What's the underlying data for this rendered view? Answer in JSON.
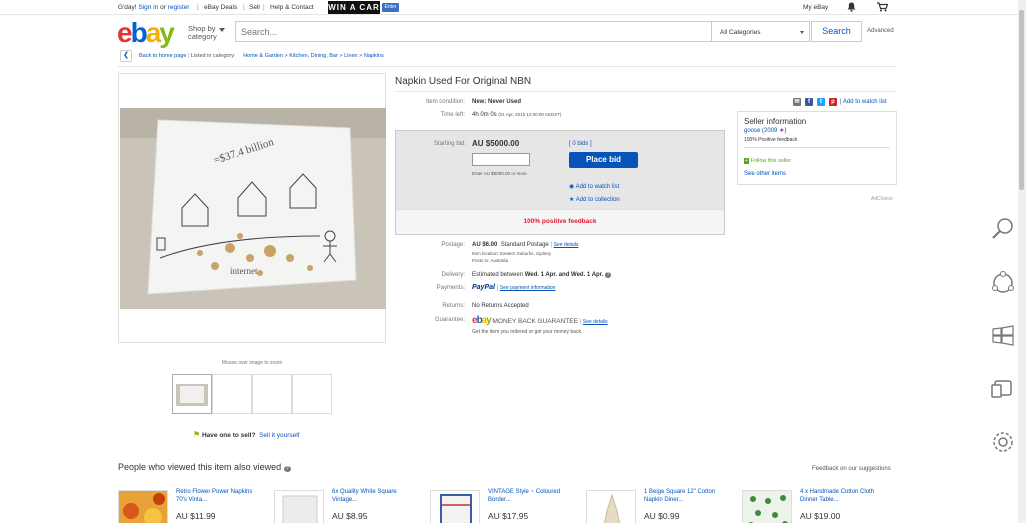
{
  "topbar": {
    "greeting": "G'day!",
    "sign_in": "Sign in",
    "or": "or",
    "register": "register",
    "deals": "eBay Deals",
    "sell": "Sell",
    "help": "Help & Contact",
    "win_banner": "WIN A CAR",
    "enter": "Enter",
    "my_ebay": "My eBay"
  },
  "header": {
    "logo": [
      "e",
      "b",
      "a",
      "y"
    ],
    "shop_by": "Shop by",
    "category": "category",
    "search_placeholder": "Search...",
    "category_select": "All Categories",
    "search_button": "Search",
    "advanced": "Advanced"
  },
  "breadcrumb": {
    "back": "Back to home page",
    "listed_in": "Listed in category:",
    "items": [
      "Home & Garden",
      "Kitchen, Dining, Bar",
      "Linen",
      "Napkins"
    ]
  },
  "gallery": {
    "zoom_hint": "Mouse over image to zoom",
    "sell_prompt": "Have one to sell?",
    "sell_link": "Sell it yourself",
    "napkin_text_1": "=$37.4 billion",
    "napkin_text_2": "internet"
  },
  "item": {
    "title": "Napkin Used For Original NBN",
    "condition_label": "Item condition:",
    "condition": "New: Never Used",
    "time_left_label": "Time left:",
    "time_left": "4h 0m 0s",
    "time_left_detail": "(01 Apr, 2015   12:00:00 AEDST)",
    "add_watch_top": "Add to watch list",
    "starting_bid_label": "Starting bid:",
    "starting_bid": "AU $5000.00",
    "bids": "[ 0 bids ]",
    "place_bid": "Place bid",
    "bid_hint": "Enter AU $5000.00 or more",
    "add_watch": "Add to watch list",
    "add_collection": "Add to collection",
    "positive_feedback": "100% positive feedback",
    "postage_label": "Postage:",
    "postage": "AU $6.00",
    "postage_type": "Standard Postage",
    "see_details": "See details",
    "item_location": "Item location:   Eastern Suburbs, Sydney",
    "posts_to": "Posts to:   Australia",
    "delivery_label": "Delivery:",
    "delivery_prefix": "Estimated between",
    "delivery_dates": "Wed. 1 Apr. and Wed. 1 Apr.",
    "payments_label": "Payments:",
    "paypal": "PayPal",
    "see_payment": "See payment information",
    "returns_label": "Returns:",
    "returns": "No Returns Accepted",
    "guarantee_label": "Guarantee:",
    "money_back": "MONEY BACK GUARANTEE",
    "guarantee_details": "See details",
    "guarantee_note": "Get the item you ordered or get your money back."
  },
  "seller": {
    "heading": "Seller information",
    "name": "goose",
    "score": "(2009",
    "score_end": ")",
    "feedback": "100% Positive feedback",
    "follow": "Follow this seller",
    "see_other": "See other items",
    "adchoice": "AdChoice"
  },
  "similar": {
    "heading": "People who viewed this item also viewed",
    "feedback": "Feedback on our suggestions",
    "items": [
      {
        "title": "Retro Flower Power Napkins 70's Vinta...",
        "price": "AU $11.99"
      },
      {
        "title": "6x Quality White Square Vintage...",
        "price": "AU $8.95"
      },
      {
        "title": "VINTAGE Style ~ Coloured Border...",
        "price": "AU $17.95"
      },
      {
        "title": "1 Beige Square 12\" Cotton Napkin Diner...",
        "price": "AU $0.99"
      },
      {
        "title": "4 x Handmade Cotton Cloth Dinner Table...",
        "price": "AU $19.00"
      }
    ]
  },
  "colors": {
    "link": "#0654ba",
    "place_bid": "#0654ba",
    "positive": "#dd1e31"
  }
}
